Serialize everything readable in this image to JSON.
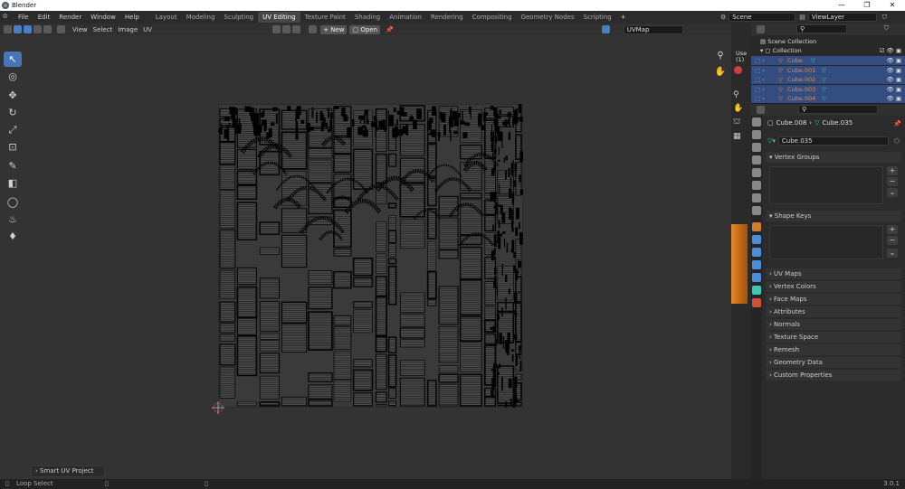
{
  "window": {
    "title": "Blender",
    "min": "—",
    "max": "❐",
    "close": "✕"
  },
  "menu": [
    "File",
    "Edit",
    "Render",
    "Window",
    "Help"
  ],
  "workspaces": [
    {
      "label": "Layout",
      "active": false
    },
    {
      "label": "Modeling",
      "active": false
    },
    {
      "label": "Sculpting",
      "active": false
    },
    {
      "label": "UV Editing",
      "active": true
    },
    {
      "label": "Texture Paint",
      "active": false
    },
    {
      "label": "Shading",
      "active": false
    },
    {
      "label": "Animation",
      "active": false
    },
    {
      "label": "Rendering",
      "active": false
    },
    {
      "label": "Compositing",
      "active": false
    },
    {
      "label": "Geometry Nodes",
      "active": false
    },
    {
      "label": "Scripting",
      "active": false
    }
  ],
  "add_tab": "+",
  "scene": {
    "label": "Scene",
    "view_layer": "ViewLayer"
  },
  "uv_header": {
    "menus": [
      "View",
      "Select",
      "Image",
      "UV"
    ],
    "new_label": "New",
    "open_label": "Open",
    "uvmap_name": "UVMap"
  },
  "tools": [
    "select-box",
    "cursor",
    "move",
    "rotate",
    "scale",
    "transform",
    "annotate",
    "rip-region",
    "grab",
    "relax",
    "pinch"
  ],
  "tool_glyphs": [
    "↖",
    "◎",
    "✥",
    "↻",
    "⤢",
    "⊡",
    "✎",
    "◧",
    "◯",
    "♨",
    "♦"
  ],
  "viewport_side": {
    "label": "Use",
    "sub": "(1)"
  },
  "redo_panel": {
    "label": "Smart UV Project"
  },
  "status": {
    "left": "Loop Select",
    "version": "3.0.1"
  },
  "outliner": {
    "root": "Scene Collection",
    "collection": "Collection",
    "items": [
      "Cube",
      "Cube.001",
      "Cube.002",
      "Cube.003",
      "Cube.004"
    ]
  },
  "properties": {
    "breadcrumb_object": "Cube.008",
    "breadcrumb_mesh": "Cube.035",
    "mesh_name": "Cube.035",
    "panels": [
      {
        "label": "Vertex Groups",
        "open": true
      },
      {
        "label": "Shape Keys",
        "open": true
      },
      {
        "label": "UV Maps",
        "open": false
      },
      {
        "label": "Vertex Colors",
        "open": false
      },
      {
        "label": "Face Maps",
        "open": false
      },
      {
        "label": "Attributes",
        "open": false
      },
      {
        "label": "Normals",
        "open": false
      },
      {
        "label": "Texture Space",
        "open": false
      },
      {
        "label": "Remesh",
        "open": false
      },
      {
        "label": "Geometry Data",
        "open": false
      },
      {
        "label": "Custom Properties",
        "open": false
      }
    ]
  },
  "colors": {
    "accent": "#4a74b8",
    "selected_row": "#334d80",
    "object_orange": "#e8873a",
    "mesh_teal": "#3fc8b0"
  }
}
